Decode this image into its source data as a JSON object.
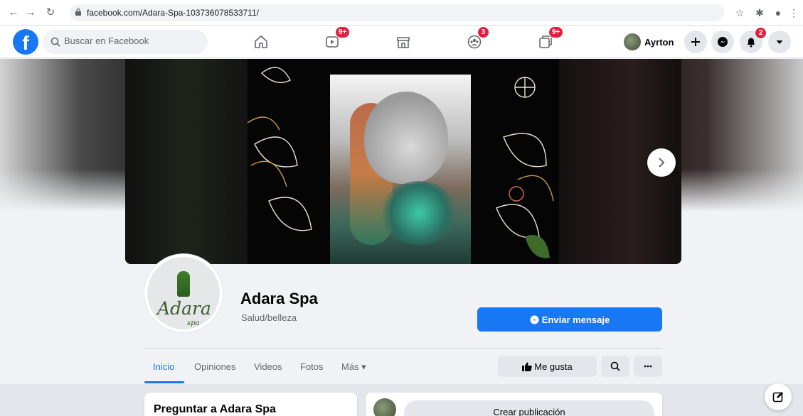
{
  "browser": {
    "url": "facebook.com/Adara-Spa-103736078533711/"
  },
  "topbar": {
    "search_placeholder": "Buscar en Facebook",
    "nav": [
      {
        "name": "home",
        "badge": ""
      },
      {
        "name": "watch",
        "badge": "9+"
      },
      {
        "name": "marketplace",
        "badge": ""
      },
      {
        "name": "groups",
        "badge": "3"
      },
      {
        "name": "gaming",
        "badge": "9+"
      }
    ],
    "user_name": "Ayrton",
    "notifications_badge": "2"
  },
  "page": {
    "name": "Adara Spa",
    "category": "Salud/belleza",
    "logo_text": "Adara",
    "logo_sub": "spa",
    "message_button": "Enviar mensaje",
    "like_button": "Me gusta"
  },
  "tabs": [
    {
      "label": "Inicio",
      "active": true
    },
    {
      "label": "Opiniones",
      "active": false
    },
    {
      "label": "Videos",
      "active": false
    },
    {
      "label": "Fotos",
      "active": false
    },
    {
      "label": "Más ▾",
      "active": false
    }
  ],
  "cards": {
    "ask_title": "Preguntar a Adara Spa",
    "create_post": "Crear publicación"
  },
  "colors": {
    "brand": "#1877f2",
    "badge": "#e41e3f"
  }
}
